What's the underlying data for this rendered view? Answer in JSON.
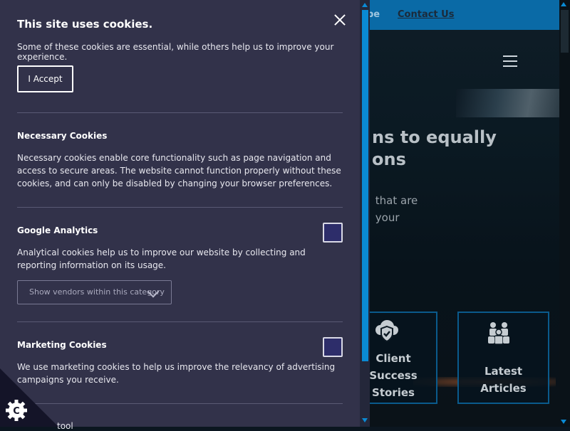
{
  "site": {
    "topbar": {
      "subscribe_partial": "be",
      "contact_label": "Contact Us"
    },
    "hero": {
      "title": "ns to equally\nons",
      "subtitle": " that are\n your"
    },
    "cards": [
      {
        "label": "Client\nSuccess\nStories",
        "icon": "shield-check-icon"
      },
      {
        "label": "Latest\nArticles",
        "icon": "people-group-icon"
      }
    ]
  },
  "cookie_panel": {
    "title": "This site uses cookies.",
    "description": "Some of these cookies are essential, while others help us to improve your experience.",
    "accept_label": "I Accept",
    "sections": [
      {
        "title": "Necessary Cookies",
        "description": "Necessary cookies enable core functionality such as page navigation and access to secure areas. The website cannot function properly without these cookies, and can only be disabled by changing your browser preferences."
      },
      {
        "title": "Google Analytics",
        "description": "Analytical cookies help us to improve our website by collecting and reporting information on its usage.",
        "vendors_label": "Show vendors within this category"
      },
      {
        "title": "Marketing Cookies",
        "description": "We use marketing cookies to help us improve the relevancy of advertising campaigns you receive."
      }
    ],
    "cut_off_text": "tool"
  },
  "colors": {
    "panel_bg": "#32324a",
    "accent": "#0a8ad4",
    "topbar": "#0a6aa6",
    "checkbox_fill": "#2d2d6a"
  }
}
